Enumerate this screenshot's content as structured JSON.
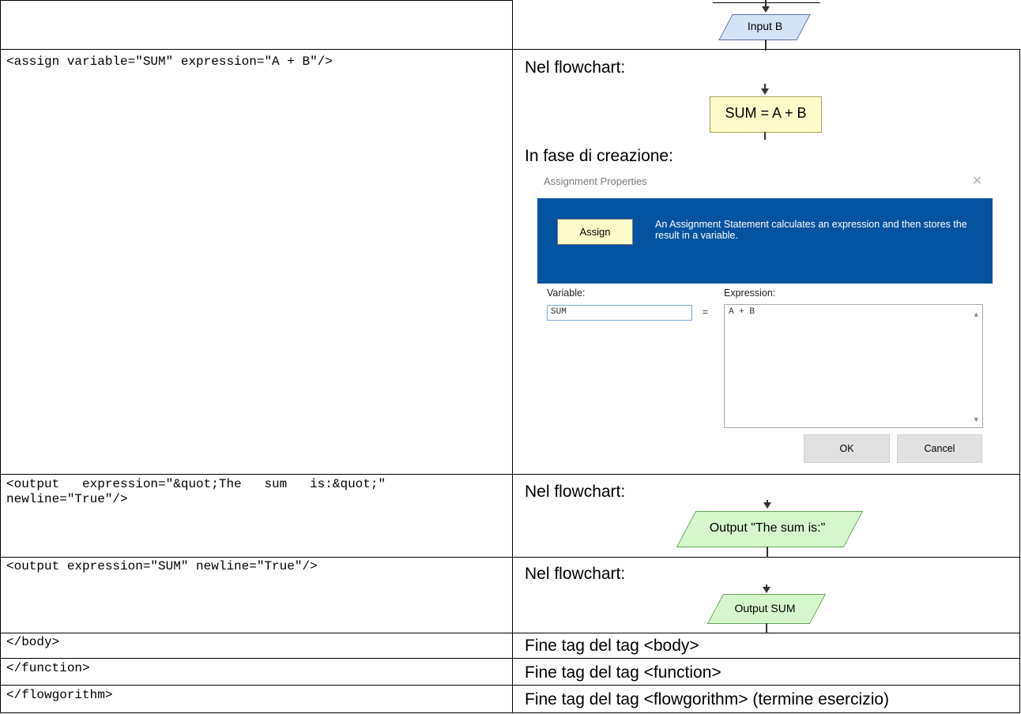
{
  "rows": [
    {
      "code": "",
      "flow": {
        "label": "Input B"
      }
    },
    {
      "code": "<assign variable=\"SUM\" expression=\"A + B\"/>",
      "heading1": "Nel flowchart:",
      "flow_label": "SUM = A + B",
      "heading2": "In fase di creazione:"
    },
    {
      "code_line1": "<output   expression=\"&quot;The   sum   is:&quot;\"",
      "code_line2": "newline=\"True\"/>",
      "heading": "Nel flowchart:",
      "flow_label": "Output \"The sum is:\""
    },
    {
      "code": "<output expression=\"SUM\" newline=\"True\"/>",
      "heading": "Nel flowchart:",
      "flow_label": "Output SUM"
    },
    {
      "code": "</body>",
      "text": "Fine tag del tag <body>"
    },
    {
      "code": "</function>",
      "text": "Fine tag del tag <function>"
    },
    {
      "code": "</flowgorithm>",
      "text": "Fine tag del tag <flowgorithm> (termine esercizio)"
    }
  ],
  "dialog": {
    "title": "Assignment Properties",
    "close": "✕",
    "chip": "Assign",
    "description": "An Assignment Statement calculates an expression and then stores the result in a variable.",
    "variable_label": "Variable:",
    "expression_label": "Expression:",
    "variable_value": "SUM",
    "equals": "=",
    "expression_value": "A + B",
    "ok": "OK",
    "cancel": "Cancel"
  },
  "colors": {
    "input_fill": "#d4e2f6",
    "output_fill": "#d6f7cc",
    "assign_fill": "#fdfbc9",
    "banner": "#0453a0"
  }
}
